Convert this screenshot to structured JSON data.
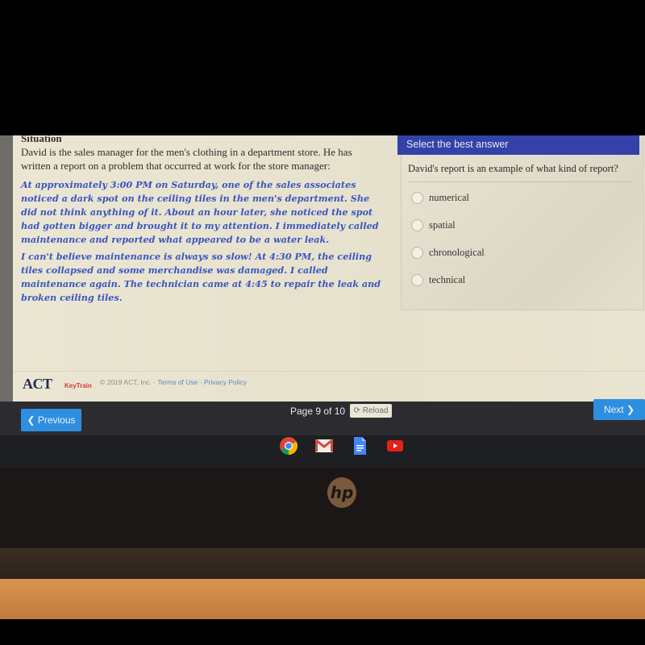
{
  "situation": {
    "title": "Situation",
    "intro": "David is the sales manager for the men's clothing in a department store. He has written a report on a problem that occurred at work for the store manager:",
    "report_paragraphs": [
      "At approximately 3:00 PM on Saturday, one of the sales associates noticed a dark spot on the ceiling tiles in the men's department. She did not think anything of it. About an hour later, she noticed the spot had gotten bigger and brought it to my attention. I immediately called maintenance and reported what appeared to be a water leak.",
      "I can't believe maintenance is always so slow! At 4:30 PM, the ceiling tiles collapsed and some merchandise was damaged. I called maintenance again. The technician came at 4:45 to repair the leak and broken ceiling tiles."
    ]
  },
  "answer_panel": {
    "header": "Select the best answer",
    "question": "David's report is an example of what kind of report?",
    "options": [
      "numerical",
      "spatial",
      "chronological",
      "technical"
    ]
  },
  "footer": {
    "logo": "ACT",
    "sublogo": "KeyTrain",
    "copyright": "© 2019 ACT, Inc. ·",
    "terms": "Terms of Use",
    "separator": "·",
    "privacy": "Privacy Policy"
  },
  "nav": {
    "previous": "❮ Previous",
    "next": "Next ❯",
    "page_indicator": "Page 9 of 10",
    "reload": "⟳ Reload"
  },
  "shelf": {
    "apps": [
      "chrome-icon",
      "gmail-icon",
      "docs-icon",
      "youtube-icon"
    ]
  },
  "device": {
    "brand": "hp"
  },
  "colors": {
    "accent": "#3441a8",
    "button": "#2e8fe0",
    "report_text": "#3a55c0"
  }
}
